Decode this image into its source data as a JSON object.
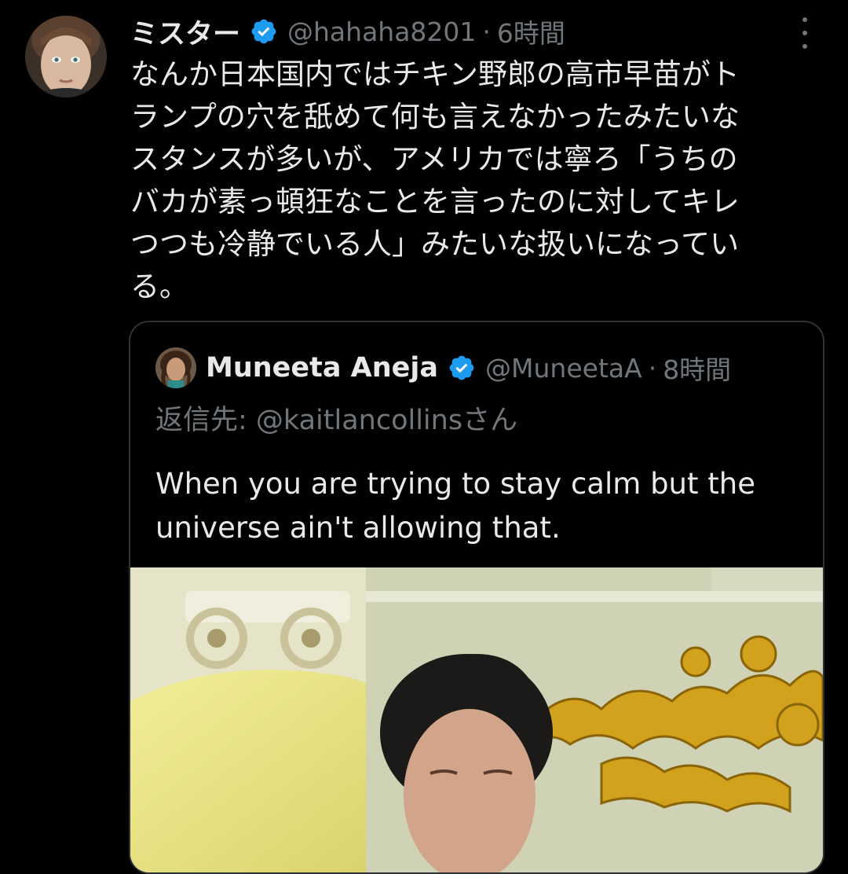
{
  "tweet": {
    "author": {
      "display_name": "ミスター",
      "handle": "@hahaha8201",
      "separator": "·",
      "time": "6時間",
      "verified": true
    },
    "body_lines": [
      "なんか日本国内ではチキン野郎の高市早苗がト",
      "ランプの穴を舐めて何も言えなかったみたいな",
      "スタンスが多いが、アメリカでは寧ろ「うちの",
      "バカが素っ頓狂なことを言ったのに対してキレ",
      "つつも冷静でいる人」みたいな扱いになってい",
      "る。"
    ],
    "more_icon": "more-vertical-icon"
  },
  "quote": {
    "author": {
      "display_name": "Muneeta Aneja",
      "handle": "@MuneetaA",
      "separator": "·",
      "time": "8時間",
      "verified": true
    },
    "reply_to": "返信先: @kaitlancollinsさん",
    "text_lines": [
      "When you are trying to stay calm but the",
      "universe ain't allowing that."
    ],
    "media": "video-thumbnail"
  },
  "colors": {
    "background": "#000000",
    "primary_text": "#e7e9ea",
    "secondary_text": "#71767b",
    "border": "#2f3336",
    "verified_blue": "#1d9bf0"
  }
}
